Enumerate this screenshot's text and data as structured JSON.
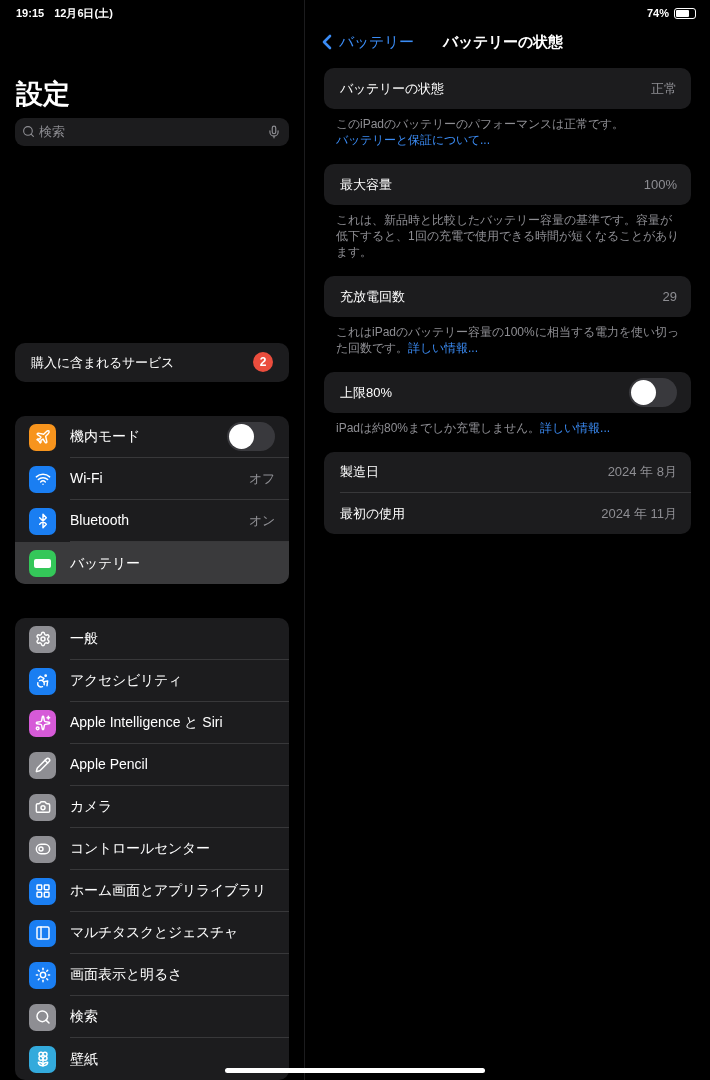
{
  "status_bar": {
    "time": "19:15",
    "date": "12月6日(土)",
    "battery": "74%"
  },
  "sidebar": {
    "title": "設定",
    "search": {
      "placeholder": "検索"
    },
    "services": {
      "label": "購入に含まれるサービス",
      "badge": "2"
    },
    "groups": [
      [
        {
          "label": "機内モード",
          "kind": "toggle",
          "on": false,
          "selected": false,
          "color": "#f7941d"
        },
        {
          "label": "Wi-Fi",
          "kind": "value",
          "value": "オフ",
          "selected": false,
          "color": "#1a7ef2"
        },
        {
          "label": "Bluetooth",
          "kind": "value",
          "value": "オン",
          "selected": false,
          "color": "#1a7ef2"
        },
        {
          "label": "バッテリー",
          "kind": "plain",
          "selected": true,
          "color": "#34c759"
        }
      ],
      [
        {
          "label": "一般",
          "kind": "plain",
          "selected": false,
          "color": "#8e8e93"
        },
        {
          "label": "アクセシビリティ",
          "kind": "plain",
          "selected": false,
          "color": "#1a7ef2"
        },
        {
          "label": "Apple Intelligence と Siri",
          "kind": "plain",
          "selected": false,
          "color": "#d65ad8"
        },
        {
          "label": "Apple Pencil",
          "kind": "plain",
          "selected": false,
          "color": "#8e8e93"
        },
        {
          "label": "カメラ",
          "kind": "plain",
          "selected": false,
          "color": "#8e8e93"
        },
        {
          "label": "コントロールセンター",
          "kind": "plain",
          "selected": false,
          "color": "#8e8e93"
        },
        {
          "label": "ホーム画面とアプリライブラリ",
          "kind": "plain",
          "selected": false,
          "color": "#1a7ef2"
        },
        {
          "label": "マルチタスクとジェスチャ",
          "kind": "plain",
          "selected": false,
          "color": "#1a7ef2"
        },
        {
          "label": "画面表示と明るさ",
          "kind": "plain",
          "selected": false,
          "color": "#1a7ef2"
        },
        {
          "label": "検索",
          "kind": "plain",
          "selected": false,
          "color": "#8e8e93"
        },
        {
          "label": "壁紙",
          "kind": "plain",
          "selected": false,
          "color": "#33aadc"
        }
      ]
    ]
  },
  "detail": {
    "back": "バッテリー",
    "title": "バッテリーの状態",
    "sections": [
      {
        "rows": [
          {
            "label": "バッテリーの状態",
            "kind": "value",
            "value": "正常"
          }
        ],
        "note": "このiPadのバッテリーのパフォーマンスは正常です。",
        "link": "バッテリーと保証について..."
      },
      {
        "rows": [
          {
            "label": "最大容量",
            "kind": "value",
            "value": "100%"
          }
        ],
        "note": "これは、新品時と比較したバッテリー容量の基準です。容量が低下すると、1回の充電で使用できる時間が短くなることがあります。"
      },
      {
        "rows": [
          {
            "label": "充放電回数",
            "kind": "value",
            "value": "29"
          }
        ],
        "note": "これはiPadのバッテリー容量の100%に相当する電力を使い切った回数です。",
        "link": "詳しい情報..."
      },
      {
        "rows": [
          {
            "label": "上限80%",
            "kind": "toggle",
            "on": false
          }
        ],
        "note": "iPadは約80%までしか充電しません。",
        "link": "詳しい情報..."
      },
      {
        "rows": [
          {
            "label": "製造日",
            "kind": "value",
            "value": "2024 年 8月"
          },
          {
            "label": "最初の使用",
            "kind": "value",
            "value": "2024 年 11月"
          }
        ]
      }
    ]
  }
}
